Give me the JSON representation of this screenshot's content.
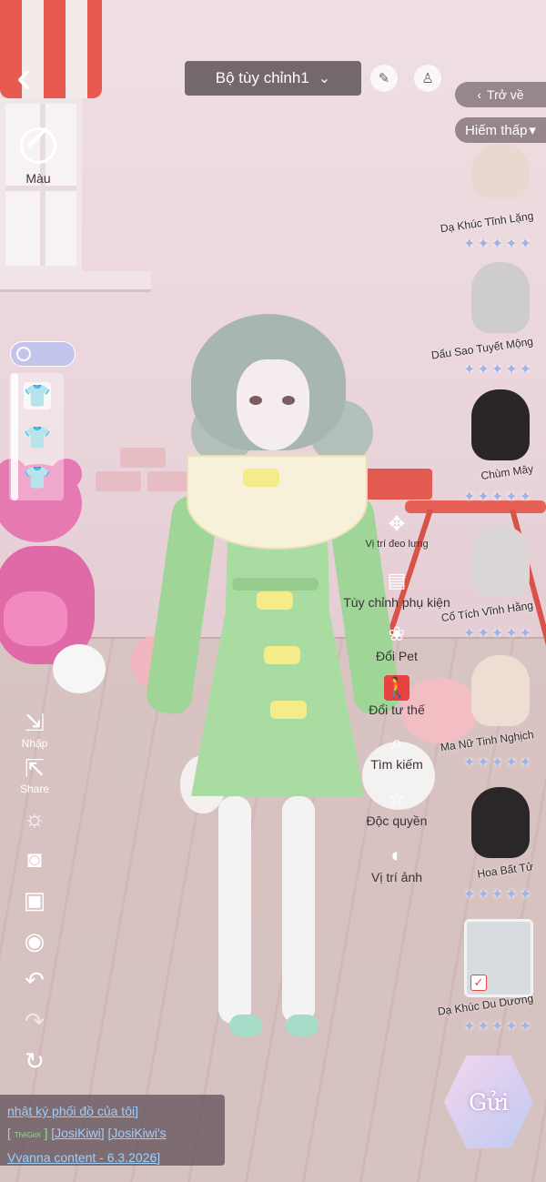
{
  "top": {
    "outfit_name": "Bộ tùy chỉnh1",
    "return_label": "Trở về",
    "filter_label": "Hiếm thấp"
  },
  "left": {
    "color_label": "Màu",
    "setting_pill_text": "",
    "tools": [
      {
        "icon": "import-icon",
        "label": "Nhập"
      },
      {
        "icon": "share-icon",
        "label": "Share"
      },
      {
        "icon": "brightness-icon",
        "label": ""
      },
      {
        "icon": "camera-icon",
        "label": ""
      },
      {
        "icon": "image-icon",
        "label": ""
      },
      {
        "icon": "eye-icon",
        "label": ""
      },
      {
        "icon": "undo-icon",
        "label": ""
      },
      {
        "icon": "redo-icon",
        "label": ""
      },
      {
        "icon": "reset-icon",
        "label": ""
      }
    ]
  },
  "actions": [
    {
      "icon": "back-accessory-icon",
      "label": "Vị trí đeo lưng"
    },
    {
      "icon": "accessory-icon",
      "label": "Tùy chỉnh phụ kiện"
    },
    {
      "icon": "paw-icon",
      "label": "Đổi Pet"
    },
    {
      "icon": "pose-icon",
      "label": "Đổi tư thế"
    },
    {
      "icon": "search-icon",
      "label": "Tìm kiếm"
    },
    {
      "icon": "star-icon",
      "label": "Độc quyền"
    },
    {
      "icon": "photo-position-icon",
      "label": "Vị trí ảnh"
    }
  ],
  "items": [
    {
      "name": "Dạ Khúc Tĩnh Lặng",
      "stars": "✦✦✦✦✦",
      "hair_color": "#e9d8cf"
    },
    {
      "name": "Dấu Sao Tuyết Mộng",
      "stars": "✦✦✦✦✦",
      "hair_color": "#cfcccd"
    },
    {
      "name": "Chùm Mây",
      "stars": "✦✦✦✦✦",
      "hair_color": "#2a2628"
    },
    {
      "name": "Cổ Tích Vĩnh Hằng",
      "stars": "✦✦✦✦✦",
      "hair_color": "#dad7d6"
    },
    {
      "name": "Ma Nữ Tinh Nghịch",
      "stars": "✦✦✦✦✦",
      "hair_color": "#efdcd2"
    },
    {
      "name": "Hoa Bất Tử",
      "stars": "✦✦✦✦✦",
      "hair_color": "#2b2729"
    },
    {
      "name": "Dạ Khúc Du Dương",
      "stars": "✦✦✦✦✦",
      "hair_color": "#b6c1bc"
    }
  ],
  "send_label": "Gửi",
  "info": {
    "line1": "nhật ký phối đồ của tôi]",
    "badge_top": "Thế",
    "badge_bottom": "Giới",
    "user": "[JosiKiwi]",
    "line3_start": "[JosiKiwi's",
    "line3_end": "Vvanna content - 6.3.2026]"
  },
  "colors": {
    "accent_red": "#e8413f",
    "star_blue": "#9fb3e8",
    "link_blue": "#9bd0ff",
    "dress_green": "#a9dca0"
  }
}
